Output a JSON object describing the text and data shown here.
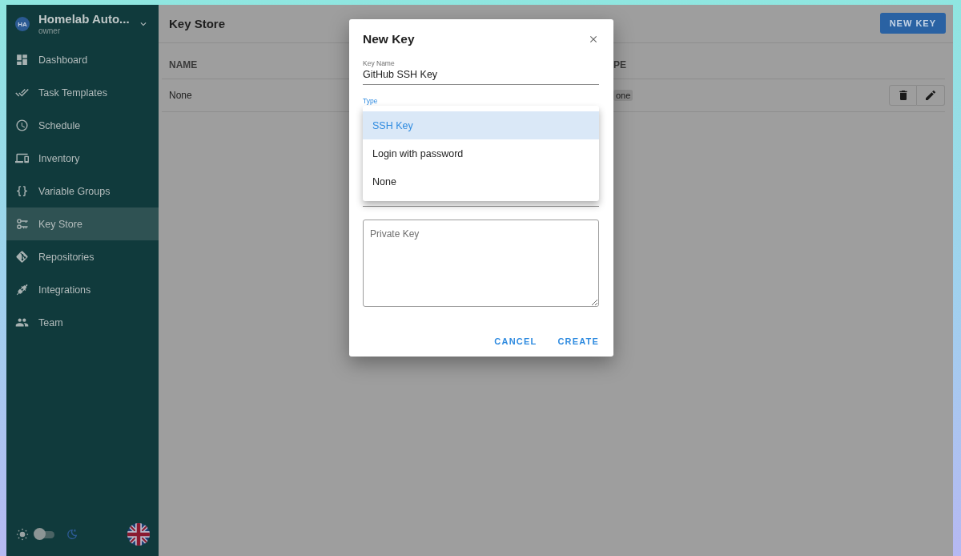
{
  "sidebar": {
    "project": {
      "initials": "HA",
      "name": "Homelab Auto...",
      "role": "owner"
    },
    "items": [
      {
        "label": "Dashboard",
        "selected": false
      },
      {
        "label": "Task Templates",
        "selected": false
      },
      {
        "label": "Schedule",
        "selected": false
      },
      {
        "label": "Inventory",
        "selected": false
      },
      {
        "label": "Variable Groups",
        "selected": false
      },
      {
        "label": "Key Store",
        "selected": true
      },
      {
        "label": "Repositories",
        "selected": false
      },
      {
        "label": "Integrations",
        "selected": false
      },
      {
        "label": "Team",
        "selected": false
      }
    ],
    "dark_mode": {
      "on": false
    }
  },
  "page": {
    "title": "Key Store",
    "new_button": "NEW KEY"
  },
  "table": {
    "columns": [
      "NAME",
      "PE"
    ],
    "rows": [
      {
        "cells": [
          "None",
          "one"
        ]
      }
    ]
  },
  "dialog": {
    "title": "New Key",
    "fields": [
      {
        "kind": "text",
        "label": "Key Name",
        "value": "GitHub SSH Key",
        "focused": false
      },
      {
        "kind": "select",
        "label": "Type",
        "focused": true
      },
      {
        "kind": "password"
      },
      {
        "kind": "textarea",
        "placeholder": "Private Key"
      }
    ],
    "menu": [
      {
        "label": "SSH Key",
        "selected": true
      },
      {
        "label": "Login with password",
        "selected": false
      },
      {
        "label": "None",
        "selected": false
      }
    ],
    "buttons": [
      "CANCEL",
      "CREATE"
    ]
  }
}
